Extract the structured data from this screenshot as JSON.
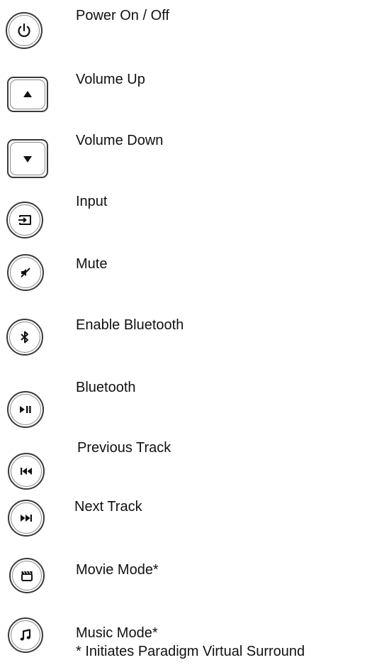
{
  "legend": {
    "items": [
      {
        "label": "Power On / Off",
        "icon": "power-icon"
      },
      {
        "label": "Volume Up",
        "icon": "triangle-up-icon"
      },
      {
        "label": "Volume Down",
        "icon": "triangle-down-icon"
      },
      {
        "label": "Input",
        "icon": "input-icon"
      },
      {
        "label": "Mute",
        "icon": "mute-icon"
      },
      {
        "label": "Enable Bluetooth",
        "icon": "bluetooth-icon"
      },
      {
        "label": "Bluetooth",
        "icon": "play-pause-icon"
      },
      {
        "label": "Previous Track",
        "icon": "previous-track-icon"
      },
      {
        "label": "Next Track",
        "icon": "next-track-icon"
      },
      {
        "label": "Movie Mode*",
        "icon": "clapperboard-icon"
      },
      {
        "label": "Music Mode*",
        "icon": "music-note-icon"
      }
    ],
    "footnote": "* Initiates Paradigm Virtual Surround"
  }
}
